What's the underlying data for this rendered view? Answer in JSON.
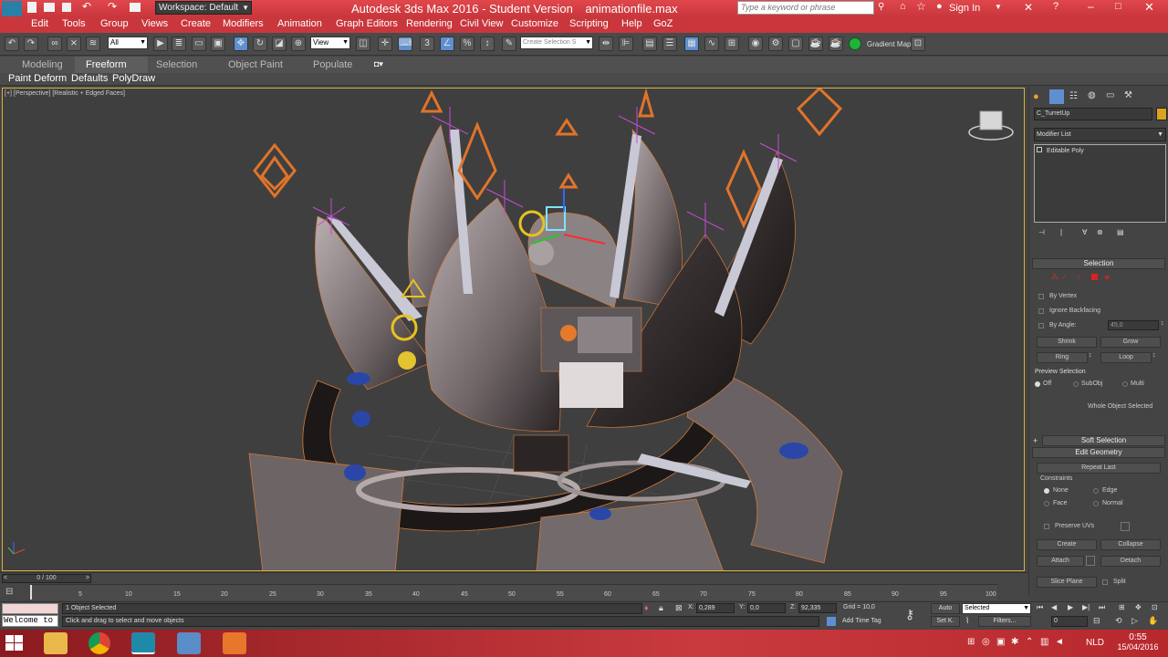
{
  "titlebar": {
    "workspace": "Workspace: Default",
    "app_title": "Autodesk 3ds Max 2016 - Student Version",
    "file_name": "animationfile.max",
    "search_placeholder": "Type a keyword or phrase",
    "sign_in": "Sign In"
  },
  "menubar": {
    "items": [
      "Edit",
      "Tools",
      "Group",
      "Views",
      "Create",
      "Modifiers",
      "Animation",
      "Graph Editors",
      "Rendering",
      "Civil View",
      "Customize",
      "Scripting",
      "Help",
      "GoZ"
    ]
  },
  "toolbar": {
    "selection_filter": "All",
    "ref_coord": "View",
    "named_selection": "Create Selection S",
    "gradient_map": "Gradient Map"
  },
  "ribbon": {
    "tabs": [
      "Modeling",
      "Freeform",
      "Selection",
      "Object Paint",
      "Populate"
    ],
    "active_tab": "Freeform",
    "sub_items": [
      "Paint Deform",
      "Defaults",
      "PolyDraw"
    ]
  },
  "viewport": {
    "label": "[+] [Perspective] [Realistic + Edged Faces]"
  },
  "command_panel": {
    "object_name": "C_TurretUp",
    "object_color": "#d9a520",
    "modifier_list": "Modifier List",
    "stack_item": "Editable Poly",
    "selection_title": "Selection",
    "by_vertex": "By Vertex",
    "ignore_backfacing": "Ignore Backfacing",
    "by_angle": "By Angle:",
    "angle_value": "45,0",
    "shrink": "Shrink",
    "grow": "Grow",
    "ring": "Ring",
    "loop": "Loop",
    "preview_selection": "Preview Selection",
    "preview_off": "Off",
    "preview_subobj": "SubObj",
    "preview_multi": "Multi",
    "whole_object": "Whole Object Selected",
    "soft_selection": "Soft Selection",
    "edit_geometry": "Edit Geometry",
    "repeat_last": "Repeat Last",
    "constraints": "Constraints",
    "c_none": "None",
    "c_edge": "Edge",
    "c_face": "Face",
    "c_normal": "Normal",
    "preserve_uvs": "Preserve UVs",
    "create": "Create",
    "collapse": "Collapse",
    "attach": "Attach",
    "detach": "Detach",
    "slice_plane": "Slice Plane",
    "split": "Split"
  },
  "timeline": {
    "frame_display": "0 / 100",
    "ticks": [
      "5",
      "10",
      "15",
      "20",
      "25",
      "30",
      "35",
      "40",
      "45",
      "50",
      "55",
      "60",
      "65",
      "70",
      "75",
      "80",
      "85",
      "90",
      "95",
      "100"
    ]
  },
  "status": {
    "maxscript": "Welcome to",
    "selected": "1 Object Selected",
    "prompt": "Click and drag to select and move objects",
    "x_label": "X:",
    "x_value": "0,289",
    "y_label": "Y:",
    "y_value": "0,0",
    "z_label": "Z:",
    "z_value": "92,335",
    "grid": "Grid = 10,0",
    "add_time_tag": "Add Time Tag",
    "auto": "Auto",
    "selected_set": "Selected",
    "set_key": "Set K.",
    "filters": "Filters...",
    "frame": "0"
  },
  "taskbar": {
    "lang": "NLD",
    "time": "0:55",
    "date": "15/04/2016"
  }
}
